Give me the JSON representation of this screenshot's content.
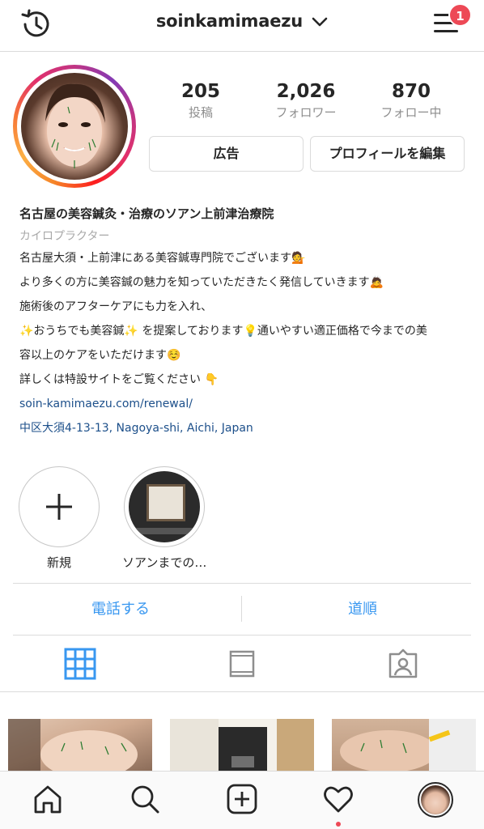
{
  "header": {
    "username": "soinkamimaezu",
    "notification_count": "1"
  },
  "profile": {
    "stats": [
      {
        "value": "205",
        "label": "投稿"
      },
      {
        "value": "2,026",
        "label": "フォロワー"
      },
      {
        "value": "870",
        "label": "フォロー中"
      }
    ],
    "buttons": {
      "ad": "広告",
      "edit_profile": "プロフィールを編集"
    }
  },
  "bio": {
    "name": "名古屋の美容鍼灸・治療のソアン上前津治療院",
    "category": "カイロプラクター",
    "lines": [
      "名古屋大須・上前津にある美容鍼専門院でございます💁",
      "より多くの方に美容鍼の魅力を知っていただきたく発信していきます🙇",
      "施術後のアフターケアにも力を入れ、",
      "✨おうちでも美容鍼✨ を提案しております💡通いやすい適正価格で今までの美",
      "容以上のケアをいただけます☺️",
      "詳しくは特設サイトをご覧ください 👇"
    ],
    "link": "soin-kamimaezu.com/renewal/",
    "address": "中区大須4-13-13, Nagoya-shi, Aichi, Japan"
  },
  "highlights": [
    {
      "label": "新規"
    },
    {
      "label": "ソアンまでの…"
    }
  ],
  "actions": {
    "call": "電話する",
    "directions": "道順"
  },
  "colors": {
    "link_blue": "#3897f0",
    "badge_red": "#ed4956",
    "muted": "#8e8e8e"
  },
  "icons": {
    "topbar": [
      "history-icon",
      "chevron-down-icon",
      "menu-icon"
    ],
    "tabs": [
      "grid-icon",
      "feed-icon",
      "tagged-icon"
    ],
    "nav": [
      "home-icon",
      "search-icon",
      "add-post-icon",
      "heart-icon",
      "profile-avatar"
    ]
  }
}
